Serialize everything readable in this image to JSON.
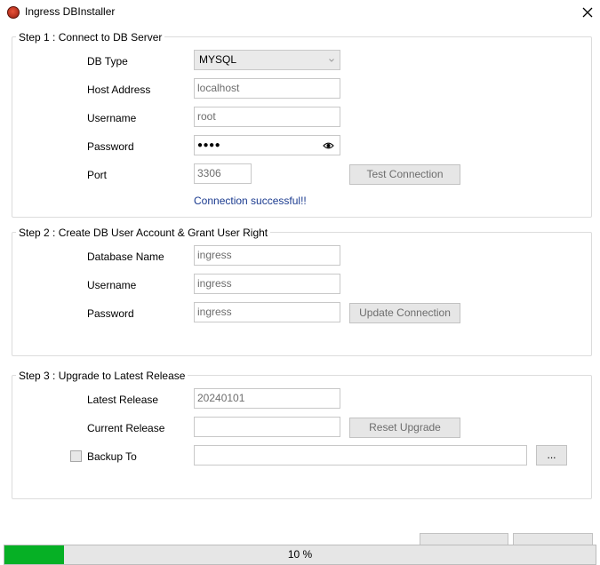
{
  "window": {
    "title": "Ingress DBInstaller"
  },
  "step1": {
    "legend": "Step 1 : Connect to DB Server",
    "db_type_label": "DB Type",
    "db_type_value": "MYSQL",
    "host_label": "Host Address",
    "host_value": "localhost",
    "username_label": "Username",
    "username_value": "root",
    "password_label": "Password",
    "password_value": "●●●●",
    "port_label": "Port",
    "port_value": "3306",
    "test_button": "Test Connection",
    "status": "Connection successful!!"
  },
  "step2": {
    "legend": "Step 2 : Create DB User Account & Grant User Right",
    "dbname_label": "Database Name",
    "dbname_value": "ingress",
    "username_label": "Username",
    "username_value": "ingress",
    "password_label": "Password",
    "password_value": "ingress",
    "update_button": "Update Connection"
  },
  "step3": {
    "legend": "Step 3 : Upgrade to Latest Release",
    "latest_label": "Latest Release",
    "latest_value": "20240101",
    "current_label": "Current Release",
    "current_value": "",
    "reset_button": "Reset Upgrade",
    "backup_label": "Backup To",
    "backup_checked": false,
    "backup_value": "",
    "browse_button": "..."
  },
  "progress": {
    "value": 10,
    "label": "10 %"
  },
  "colors": {
    "progress_fill": "#06b025",
    "status_text": "#1a3a8f"
  }
}
